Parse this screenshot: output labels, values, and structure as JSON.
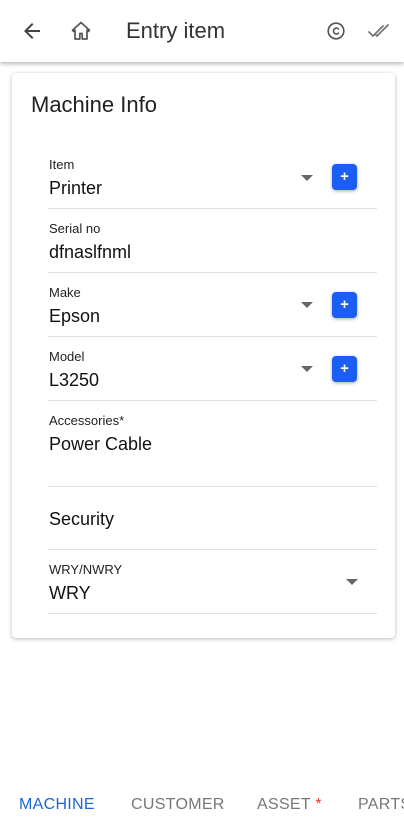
{
  "header": {
    "title": "Entry item",
    "icons": [
      "back-arrow-icon",
      "home-icon",
      "copyright-icon",
      "double-check-icon"
    ]
  },
  "card": {
    "title": "Machine Info",
    "fields": {
      "item": {
        "label": "Item",
        "value": "Printer",
        "add_label": "+"
      },
      "serial": {
        "label": "Serial no",
        "value": "dfnaslfnml"
      },
      "make": {
        "label": "Make",
        "value": "Epson",
        "add_label": "+"
      },
      "model": {
        "label": "Model",
        "value": "L3250",
        "add_label": "+"
      },
      "accessories": {
        "label": "Accessories*",
        "value": "Power Cable"
      },
      "security": {
        "value": "Security"
      },
      "wry": {
        "label": "WRY/NWRY",
        "value": "WRY"
      }
    }
  },
  "tabs": [
    {
      "label": "MACHINE",
      "active": true
    },
    {
      "label": "CUSTOMER",
      "active": false
    },
    {
      "label": "ASSET",
      "required_mark": "*",
      "active": false
    },
    {
      "label": "PARTS",
      "active": false
    }
  ],
  "colors": {
    "accent": "#1a66d8",
    "button": "#1a5ff1",
    "required": "#e53935"
  }
}
